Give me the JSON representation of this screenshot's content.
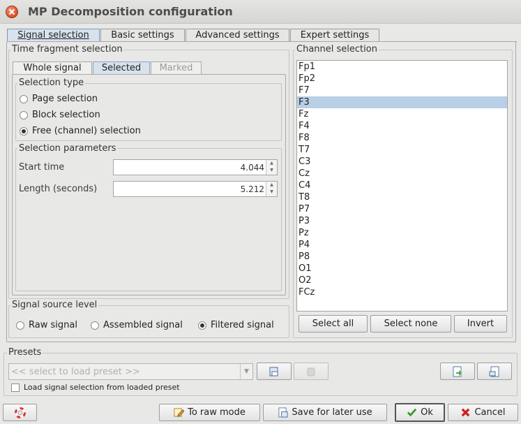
{
  "window": {
    "title": "MP Decomposition configuration"
  },
  "tabs": [
    {
      "label": "Signal selection"
    },
    {
      "label": "Basic settings"
    },
    {
      "label": "Advanced settings"
    },
    {
      "label": "Expert settings"
    }
  ],
  "time_fragment": {
    "title": "Time fragment selection",
    "subtabs": [
      {
        "label": "Whole signal"
      },
      {
        "label": "Selected"
      },
      {
        "label": "Marked"
      }
    ],
    "selection_type": {
      "title": "Selection type",
      "options": [
        {
          "label": "Page selection",
          "checked": false
        },
        {
          "label": "Block selection",
          "checked": false
        },
        {
          "label": "Free (channel) selection",
          "checked": true
        }
      ]
    },
    "parameters": {
      "title": "Selection parameters",
      "start_time_label": "Start time",
      "start_time_value": "4.044",
      "length_label": "Length (seconds)",
      "length_value": "5.212"
    }
  },
  "source_level": {
    "title": "Signal source level",
    "options": [
      {
        "label": "Raw signal",
        "checked": false
      },
      {
        "label": "Assembled signal",
        "checked": false
      },
      {
        "label": "Filtered signal",
        "checked": true
      }
    ]
  },
  "channels": {
    "title": "Channel selection",
    "items": [
      "Fp1",
      "Fp2",
      "F7",
      "F3",
      "Fz",
      "F4",
      "F8",
      "T7",
      "C3",
      "Cz",
      "C4",
      "T8",
      "P7",
      "P3",
      "Pz",
      "P4",
      "P8",
      "O1",
      "O2",
      "FCz"
    ],
    "selected": "F3",
    "select_all": "Select all",
    "select_none": "Select none",
    "invert": "Invert"
  },
  "presets": {
    "title": "Presets",
    "placeholder": "<< select to load preset >>",
    "load_checkbox_label": "Load signal selection from loaded preset"
  },
  "footer": {
    "raw_mode": "To raw mode",
    "save_later": "Save for later use",
    "ok": "Ok",
    "cancel": "Cancel"
  }
}
